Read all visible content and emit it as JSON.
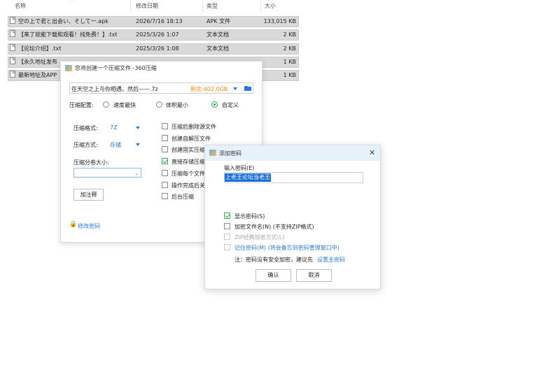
{
  "explorer": {
    "headers": {
      "name": "名称",
      "date": "修改日期",
      "type": "类型",
      "size": "大小"
    },
    "rows": [
      {
        "name": "空の上で君と出会い、そして一.apk",
        "date": "2026/7/16 18:13",
        "type": "APK 文件",
        "size": "133,015 KB"
      },
      {
        "name": "【来了就能下载和观看！纯免费！】.txt",
        "date": "2025/3/26 1:07",
        "type": "文本文档",
        "size": "2 KB"
      },
      {
        "name": "【论坛介绍】.txt",
        "date": "2025/3/26 1:08",
        "type": "文本文档",
        "size": "2 KB"
      },
      {
        "name": "【永久地址发布",
        "date": "",
        "type": "",
        "size": "1 KB"
      },
      {
        "name": "最新地址及APP",
        "date": "",
        "type": "",
        "size": "1 KB"
      }
    ]
  },
  "compress_dialog": {
    "title": "您将创建一个压缩文件 -360压缩",
    "path": "在天空之上与你相遇，然后——.7z",
    "free_space": "剩余:402.0GB",
    "config_label": "压缩配置:",
    "options": {
      "fast": "速度最快",
      "small": "体积最小",
      "custom": "自定义"
    },
    "format_label": "压缩格式:",
    "format_value": "7Z",
    "method_label": "压缩方式:",
    "method_value": "存储",
    "split_label": "压缩分卷大小:",
    "split_value": "",
    "comment_button": "加注释",
    "password_link": "修改密码",
    "checks": [
      {
        "label": "压缩后删除源文件",
        "checked": false
      },
      {
        "label": "创建自解压文件",
        "checked": false
      },
      {
        "label": "创建固实压缩",
        "checked": false
      },
      {
        "label": "直接存储压缩",
        "checked": true
      },
      {
        "label": "压缩每个文件",
        "checked": false
      },
      {
        "label": "操作完成后关",
        "checked": false
      },
      {
        "label": "后台压缩",
        "checked": false
      }
    ]
  },
  "password_dialog": {
    "title": "添加密码",
    "input_label": "输入密码(E)",
    "password_value": "上老王论坛当老王",
    "show_password": "显示密码(S)",
    "encrypt_names": "加密文件名(N) (不支持ZIP格式)",
    "zip_classic": "ZIP经典加密方式(L)",
    "remember": "记住密码(M) (将会备忘到密码管理窗口中)",
    "note_prefix": "注：密码没有安全加密，建议先",
    "note_link": "设置主密码",
    "ok_button": "确认",
    "cancel_button": "取消"
  },
  "colors": {
    "accent": "#2a7ad5",
    "free_space": "#f08a1c",
    "check_green": "#2aa14a",
    "selection": "#1a6fd6",
    "row_selected": "#d9d9d9"
  }
}
